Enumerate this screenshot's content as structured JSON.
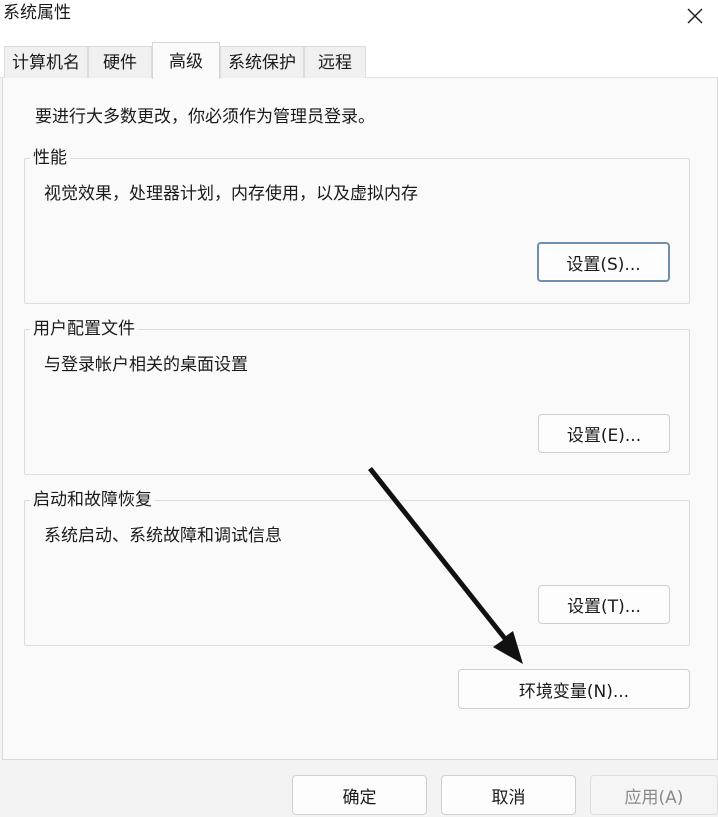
{
  "window": {
    "title": "系统属性"
  },
  "tabs": [
    {
      "label": "计算机名"
    },
    {
      "label": "硬件"
    },
    {
      "label": "高级"
    },
    {
      "label": "系统保护"
    },
    {
      "label": "远程"
    }
  ],
  "admin_note": "要进行大多数更改，你必须作为管理员登录。",
  "groups": {
    "performance": {
      "title": "性能",
      "description": "视觉效果，处理器计划，内存使用，以及虚拟内存",
      "button": "设置(S)..."
    },
    "user_profiles": {
      "title": "用户配置文件",
      "description": "与登录帐户相关的桌面设置",
      "button": "设置(E)..."
    },
    "startup_recovery": {
      "title": "启动和故障恢复",
      "description": "系统启动、系统故障和调试信息",
      "button": "设置(T)..."
    }
  },
  "env_button": "环境变量(N)...",
  "footer": {
    "ok": "确定",
    "cancel": "取消",
    "apply": "应用(A)"
  },
  "icons": {
    "close": "close-icon",
    "annotation": "annotation-arrow"
  },
  "colors": {
    "focus_border": "#6e8fb0",
    "arrow": "#111111"
  }
}
